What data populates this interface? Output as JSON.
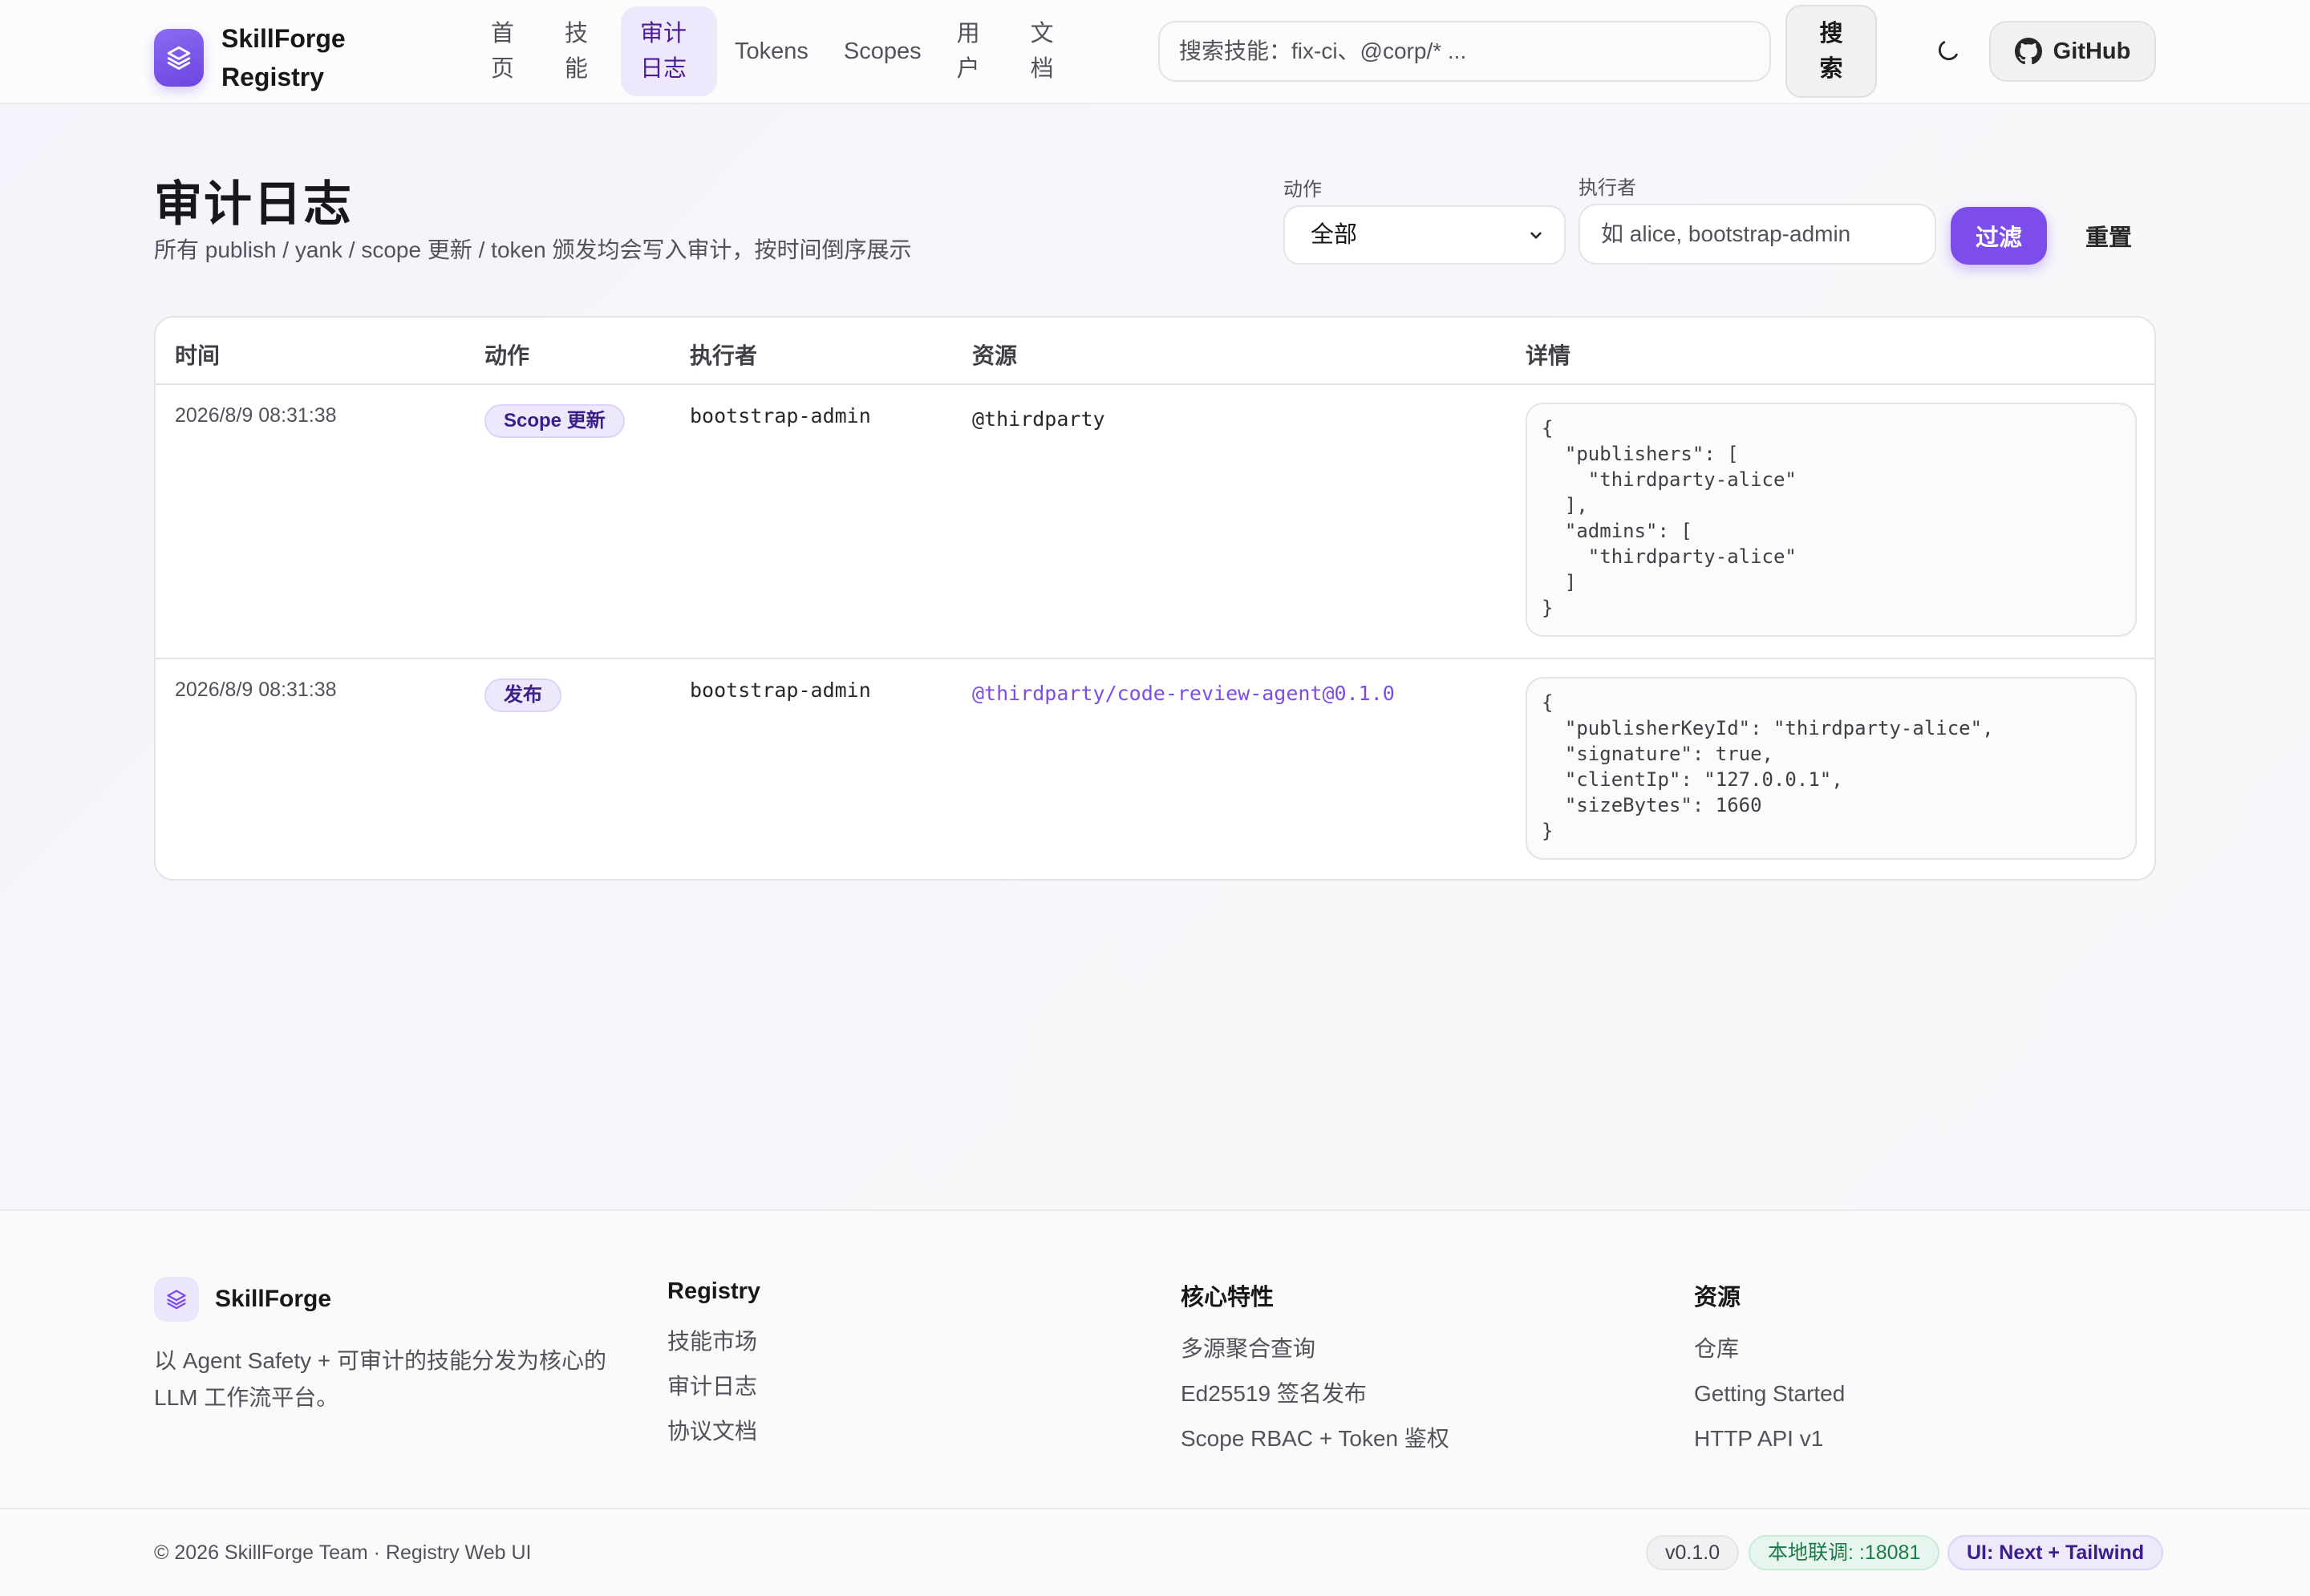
{
  "header": {
    "brand": "SkillForge Registry",
    "nav": [
      {
        "label": "首页"
      },
      {
        "label": "技能"
      },
      {
        "label": "审计日志",
        "active": true
      },
      {
        "label": "Tokens"
      },
      {
        "label": "Scopes"
      },
      {
        "label": "用户"
      },
      {
        "label": "文档"
      }
    ],
    "search_placeholder": "搜索技能：fix-ci、@corp/* ...",
    "search_button": "搜索",
    "theme_icon": "moon-icon",
    "github_label": "GitHub"
  },
  "page": {
    "title": "审计日志",
    "subtitle": "所有 publish / yank / scope 更新 / token 颁发均会写入审计，按时间倒序展示"
  },
  "filters": {
    "action_label": "动作",
    "action_value": "全部",
    "actor_label": "执行者",
    "actor_placeholder": "如 alice, bootstrap-admin",
    "filter_button": "过滤",
    "reset_button": "重置"
  },
  "table": {
    "columns": [
      "时间",
      "动作",
      "执行者",
      "资源",
      "详情"
    ],
    "rows": [
      {
        "time": "2026/8/9 08:31:38",
        "action": "Scope 更新",
        "actor": "bootstrap-admin",
        "resource": "@thirdparty",
        "details": "{\n  \"publishers\": [\n    \"thirdparty-alice\"\n  ],\n  \"admins\": [\n    \"thirdparty-alice\"\n  ]\n}"
      },
      {
        "time": "2026/8/9 08:31:38",
        "action": "发布",
        "actor": "bootstrap-admin",
        "resource": "@thirdparty/code-review-agent@0.1.0",
        "details": "{\n  \"publisherKeyId\": \"thirdparty-alice\",\n  \"signature\": true,\n  \"clientIp\": \"127.0.0.1\",\n  \"sizeBytes\": 1660\n}"
      }
    ]
  },
  "footer": {
    "brand": "SkillForge",
    "description": "以 Agent Safety + 可审计的技能分发为核心的 LLM 工作流平台。",
    "columns": [
      {
        "title": "Registry",
        "links": [
          "技能市场",
          "审计日志",
          "协议文档"
        ]
      },
      {
        "title": "核心特性",
        "links": [
          "多源聚合查询",
          "Ed25519 签名发布",
          "Scope RBAC + Token 鉴权"
        ]
      },
      {
        "title": "资源",
        "links": [
          "仓库",
          "Getting Started",
          "HTTP API v1"
        ]
      }
    ],
    "copyright": "© 2026 SkillForge Team · Registry Web UI",
    "badges": {
      "version": "v0.1.0",
      "local": "本地联调: :18081",
      "ui": "UI: Next + Tailwind"
    }
  },
  "colors": {
    "accent": "#7c4dea",
    "badge_bg": "#ede8fb",
    "link": "#7c4dea"
  }
}
